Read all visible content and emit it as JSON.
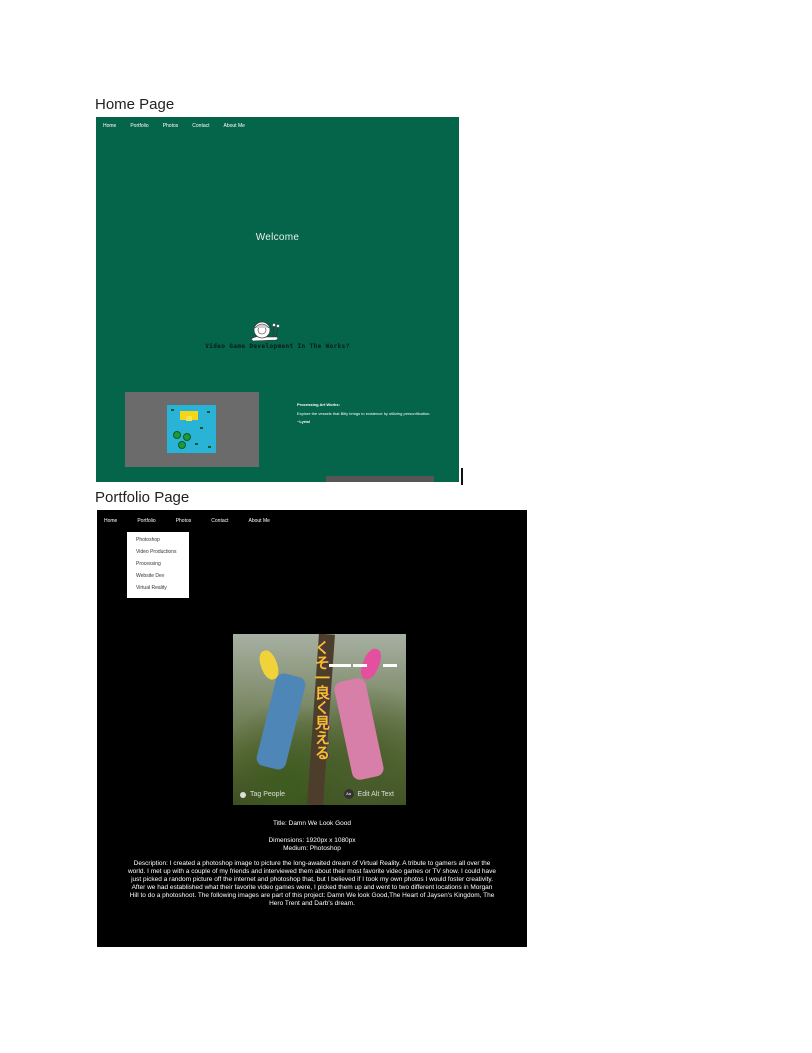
{
  "labels": {
    "home_page": "Home Page",
    "portfolio_page": "Portfolio Page"
  },
  "home": {
    "nav": [
      "Home",
      "Portfolio",
      "Photos",
      "Contact",
      "About Me"
    ],
    "welcome": "Welcome",
    "video_game_text": "Video Game Development In The Works?",
    "processing": {
      "title": "Processing Art Works:",
      "description": "Explore the vessels that Bitly brings to existence by utilizing personification.",
      "signature": "~Lyrial"
    },
    "colors": {
      "background": "#05654a",
      "panel": "#6b6b6b"
    }
  },
  "portfolio": {
    "nav": [
      "Home",
      "Portfolio",
      "Photos",
      "Contact",
      "About Me"
    ],
    "dropdown": [
      "Photoshop",
      "Video Productions",
      "Processing",
      "Website Dev",
      "Virtual Reality"
    ],
    "artwork": {
      "vertical_text": "くそ一良く見える",
      "tag_people": "Tag People",
      "edit_alt": "Edit Alt Text",
      "alt_badge": "Aa"
    },
    "title": "Title: Damn We Look Good",
    "dimensions": "Dimensions: 1920px x 1080px",
    "medium": "Medium: Photoshop",
    "description": "Description: I created a photoshop image to picture the long-awaited dream of Virtual Reality. A tribute to gamers all over the world. I met up with a couple of my friends and interviewed them about their most favorite video games or TV show. I could have just picked a random picture off the internet and photoshop that, but I believed if I took my own photos I would foster creativity. After we had established what their favorite video games were, I picked them up and went to two different locations in Morgan Hill to do a photoshoot. The following images are part of this project: Damn We look Good,The Heart of Jaysen's Kingdom, The Hero Trent and Darb's dream.",
    "colors": {
      "background": "#000000"
    }
  }
}
